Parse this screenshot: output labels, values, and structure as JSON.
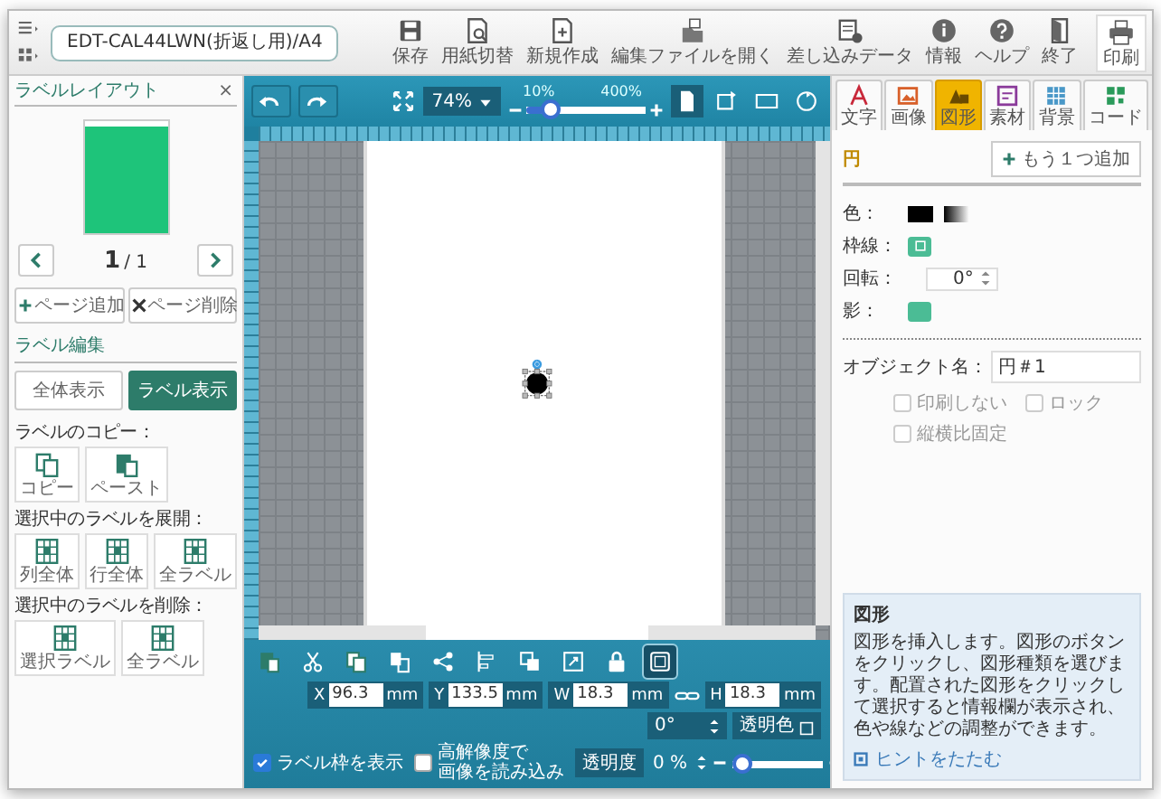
{
  "file_name": "EDT-CAL44LWN(折返し用)/A4",
  "toolbar": [
    {
      "kind": "save",
      "label": "保存"
    },
    {
      "kind": "paper",
      "label": "用紙切替"
    },
    {
      "kind": "new",
      "label": "新規作成"
    },
    {
      "kind": "open",
      "label": "編集ファイルを開く"
    },
    {
      "kind": "merge",
      "label": "差し込みデータ"
    },
    {
      "kind": "info",
      "label": "情報"
    },
    {
      "kind": "help",
      "label": "ヘルプ"
    },
    {
      "kind": "exit",
      "label": "終了"
    },
    {
      "kind": "print",
      "label": "印刷"
    }
  ],
  "left_panel": {
    "title": "ラベルレイアウト",
    "close": "×",
    "page_current": "1",
    "page_total": "/ 1",
    "page_buttons": [
      {
        "kind": "add",
        "label": "ページ追加"
      },
      {
        "kind": "delete",
        "label": "ページ削除"
      }
    ],
    "edit_title": "ラベル編集",
    "view_toggle": [
      {
        "label": "全体表示",
        "selected": false
      },
      {
        "label": "ラベル表示",
        "selected": true
      }
    ],
    "groups": [
      {
        "title": "ラベルのコピー：",
        "buttons": [
          {
            "kind": "copy",
            "label": "コピー"
          },
          {
            "kind": "paste",
            "label": "ペースト"
          }
        ]
      },
      {
        "title": "選択中のラベルを展開：",
        "buttons": [
          {
            "kind": "grid",
            "label": "列全体"
          },
          {
            "kind": "grid",
            "label": "行全体"
          },
          {
            "kind": "grid",
            "label": "全ラベル"
          }
        ]
      },
      {
        "title": "選択中のラベルを削除：",
        "buttons": [
          {
            "kind": "grid",
            "label": "選択ラベル"
          },
          {
            "kind": "grid",
            "label": "全ラベル"
          }
        ]
      }
    ]
  },
  "canvas": {
    "zoom": "74%",
    "zoom_min": "10%",
    "zoom_max": "400%",
    "zoom_slider": {
      "level": 0.15
    },
    "tools": [
      {
        "kind": "paste",
        "selected": false
      },
      {
        "kind": "cut",
        "selected": false
      },
      {
        "kind": "copy",
        "selected": false
      },
      {
        "kind": "duplicate",
        "selected": false
      },
      {
        "kind": "arrange",
        "selected": false
      },
      {
        "kind": "align",
        "selected": false
      },
      {
        "kind": "order",
        "selected": false
      },
      {
        "kind": "resize",
        "selected": false
      },
      {
        "kind": "lock",
        "selected": false
      },
      {
        "kind": "group",
        "selected": true
      }
    ],
    "fields": [
      {
        "label": "X",
        "value": "96.3",
        "unit": "mm"
      },
      {
        "label": "Y",
        "value": "133.5",
        "unit": "mm"
      },
      {
        "label": "W",
        "value": "18.3",
        "unit": "mm"
      },
      {
        "label": "H",
        "value": "18.3",
        "unit": "mm"
      }
    ],
    "rotation": "0°",
    "transparent_color": "透明色",
    "checkboxes": [
      {
        "label": "ラベル枠を表示",
        "checked": true
      },
      {
        "label_lines": [
          "高解像度で",
          "画像を読み込み"
        ],
        "checked": false
      }
    ],
    "opacity_label": "透明度",
    "opacity_value": "0 %",
    "opacity_slider": {
      "level": 0
    }
  },
  "right_panel": {
    "tabs": [
      {
        "kind": "text",
        "label": "文字",
        "selected": false
      },
      {
        "kind": "image",
        "label": "画像",
        "selected": false
      },
      {
        "kind": "shape",
        "label": "図形",
        "selected": true
      },
      {
        "kind": "material",
        "label": "素材",
        "selected": false
      },
      {
        "kind": "background",
        "label": "背景",
        "selected": false
      },
      {
        "kind": "code",
        "label": "コード",
        "selected": false
      }
    ],
    "heading": "円",
    "add_button": "もう１つ追加",
    "color_label": "色：",
    "border_label": "枠線：",
    "rotation_label": "回転：",
    "rotation": "0°",
    "shadow_label": "影：",
    "object_name_label": "オブジェクト名：",
    "object_name": "円＃1",
    "options": [
      {
        "label": "印刷しない",
        "checked": false
      },
      {
        "label": "ロック",
        "checked": false
      },
      {
        "label": "縦横比固定",
        "checked": false
      }
    ],
    "hint_title": "図形",
    "hint_text": "図形を挿入します。図形のボタンをクリックし、図形種類を選びます。配置された図形をクリックして選択すると情報欄が表示され、色や線などの調整ができます。",
    "hint_toggle": "ヒントをたたむ"
  }
}
